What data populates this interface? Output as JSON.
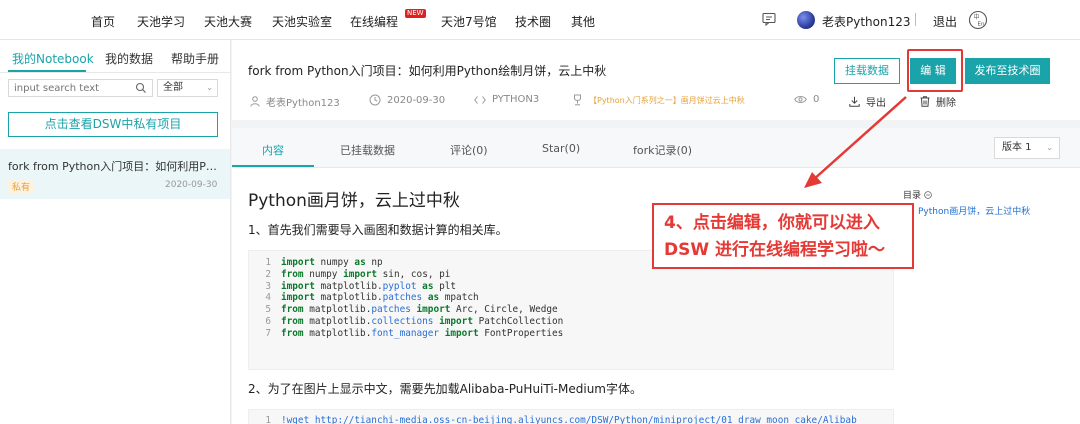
{
  "nav": {
    "items": [
      "首页",
      "天池学习",
      "天池大赛",
      "天池实验室",
      "在线编程",
      "天池7号馆",
      "技术圈",
      "其他"
    ],
    "new_badge": "NEW",
    "user_name": "老表Python123",
    "logout": "退出"
  },
  "sidebar": {
    "tabs": [
      "我的Notebook",
      "我的数据",
      "帮助手册"
    ],
    "search_placeholder": "input search text",
    "filter_value": "全部",
    "private_button": "点击查看DSW中私有项目",
    "project": {
      "title": "fork from Python入门项目：如何利用Pyt...",
      "badge": "私有",
      "date": "2020-09-30"
    }
  },
  "header": {
    "title": "fork from Python入门项目：如何利用Python绘制月饼，云上中秋",
    "mount_button": "挂载数据",
    "edit_button": "编 辑",
    "publish_button": "发布至技术圈",
    "author": "老表Python123",
    "date": "2020-09-30",
    "language": "PYTHON3",
    "tag": "【Python入门系列之一】画月饼过云上中秋",
    "views": "0",
    "export": "导出",
    "delete": "删除"
  },
  "content": {
    "tabs": [
      "内容",
      "已挂载数据",
      "评论(0)",
      "Star(0)",
      "fork记录(0)"
    ],
    "version": "版本 1",
    "heading": "Python画月饼，云上过中秋",
    "step1": "1、首先我们需要导入画图和数据计算的相关库。",
    "code_lines": [
      "import numpy as np",
      "from numpy import sin, cos, pi",
      "import matplotlib.pyplot as plt",
      "import matplotlib.patches as mpatch",
      "from matplotlib.patches import Arc, Circle, Wedge",
      "from matplotlib.collections import PatchCollection",
      "from matplotlib.font_manager import FontProperties"
    ],
    "step2": "2、为了在图片上显示中文，需要先加载Alibaba-PuHuiTi-Medium字体。",
    "code2": "!wget http://tianchi-media.oss-cn-beijing.aliyuncs.com/DSW/Python/miniproject/01_draw_moon_cake/Alibab",
    "toc_label": "目录",
    "toc_item": "Python画月饼，云上过中秋"
  },
  "annotation": {
    "line1": "4、点击编辑，你就可以进入",
    "line2": "DSW 进行在线编程学习啦～"
  },
  "colors": {
    "accent": "#1aa3a9",
    "annotation": "#e53935",
    "tag": "#e6a23c"
  }
}
